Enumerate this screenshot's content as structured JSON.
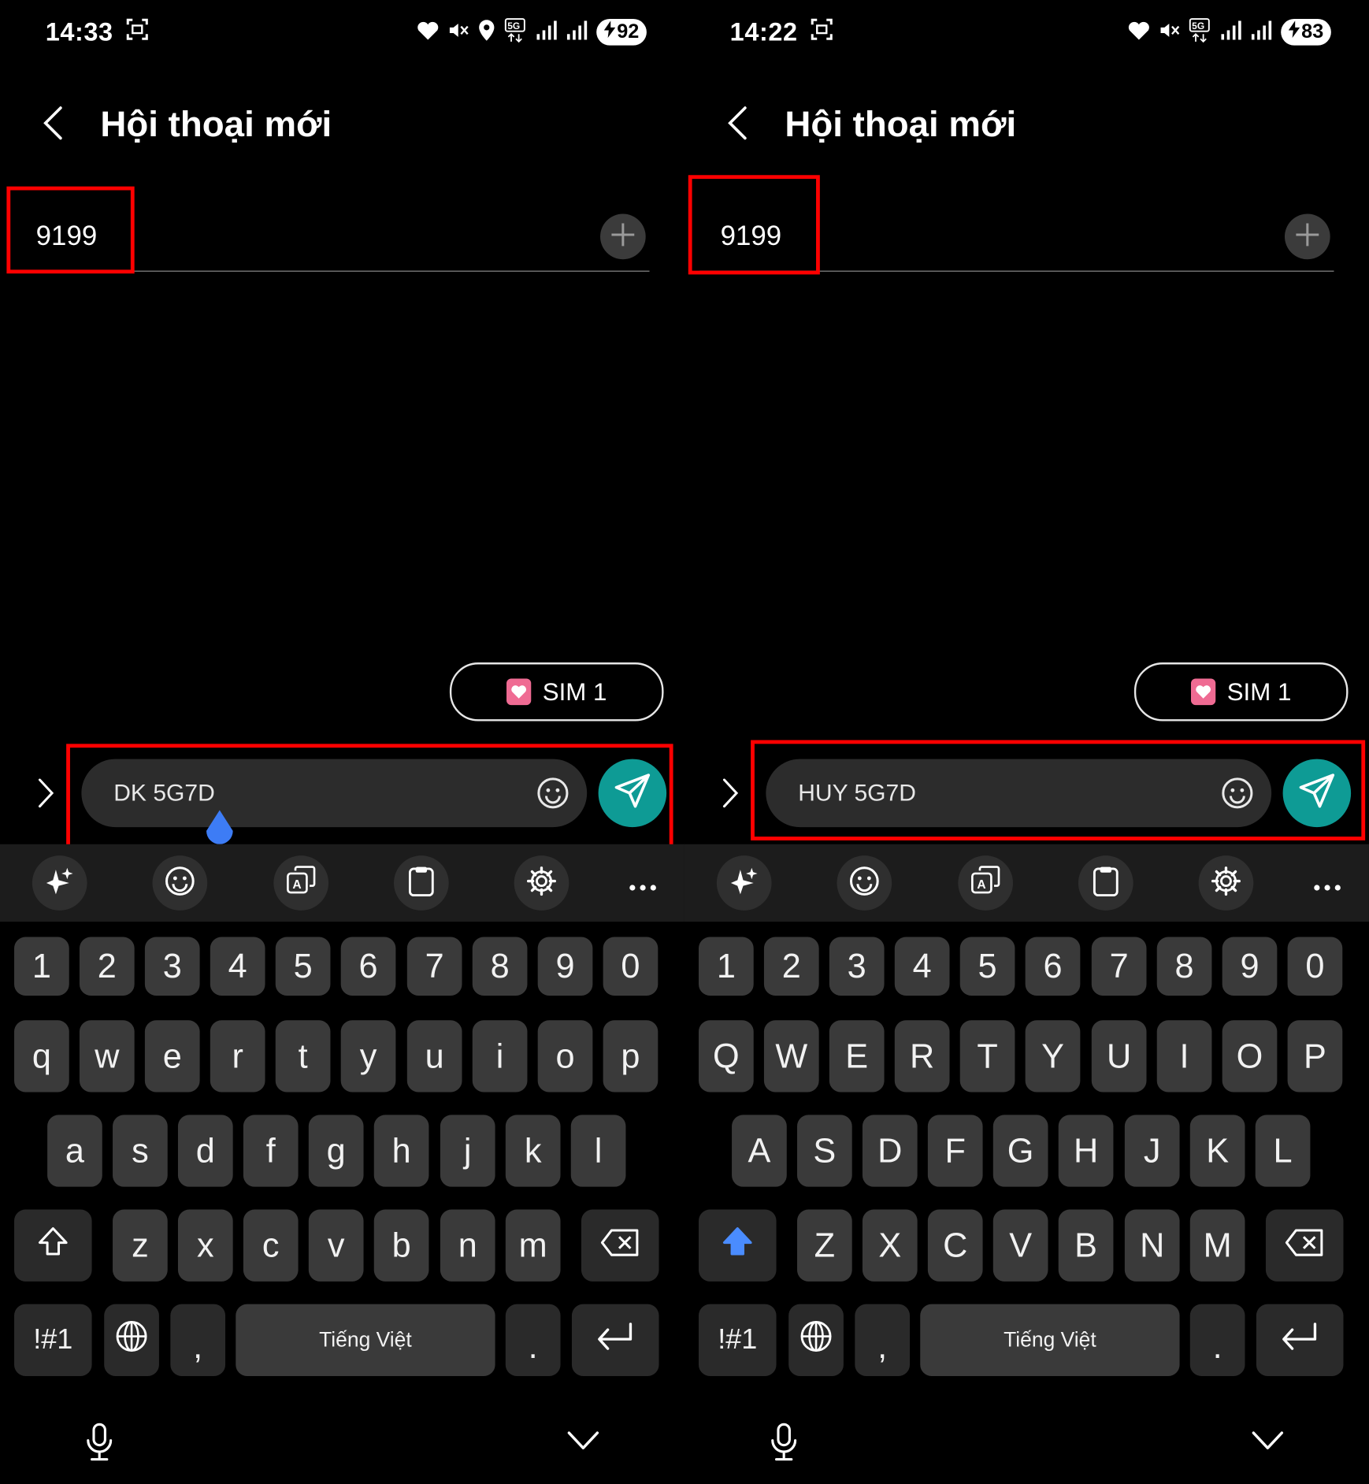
{
  "screens": [
    {
      "status": {
        "time": "14:33",
        "battery": "92"
      },
      "header": {
        "title": "Hội thoại mới"
      },
      "recipient": {
        "number": "9199"
      },
      "sim_label": "SIM 1",
      "compose": {
        "text": "DK 5G7D"
      },
      "keyboard": {
        "numbers": [
          "1",
          "2",
          "3",
          "4",
          "5",
          "6",
          "7",
          "8",
          "9",
          "0"
        ],
        "row1": [
          "q",
          "w",
          "e",
          "r",
          "t",
          "y",
          "u",
          "i",
          "o",
          "p"
        ],
        "row2": [
          "a",
          "s",
          "d",
          "f",
          "g",
          "h",
          "j",
          "k",
          "l"
        ],
        "row3": [
          "z",
          "x",
          "c",
          "v",
          "b",
          "n",
          "m"
        ],
        "symbols_label": "!#1",
        "comma": ",",
        "space_label": "Tiếng Việt",
        "period": ".",
        "shift_active": false
      }
    },
    {
      "status": {
        "time": "14:22",
        "battery": "83"
      },
      "header": {
        "title": "Hội thoại mới"
      },
      "recipient": {
        "number": "9199"
      },
      "sim_label": "SIM 1",
      "compose": {
        "text": "HUY 5G7D"
      },
      "keyboard": {
        "numbers": [
          "1",
          "2",
          "3",
          "4",
          "5",
          "6",
          "7",
          "8",
          "9",
          "0"
        ],
        "row1": [
          "Q",
          "W",
          "E",
          "R",
          "T",
          "Y",
          "U",
          "I",
          "O",
          "P"
        ],
        "row2": [
          "A",
          "S",
          "D",
          "F",
          "G",
          "H",
          "J",
          "K",
          "L"
        ],
        "row3": [
          "Z",
          "X",
          "C",
          "V",
          "B",
          "N",
          "M"
        ],
        "symbols_label": "!#1",
        "comma": ",",
        "space_label": "Tiếng Việt",
        "period": ".",
        "shift_active": true
      }
    }
  ],
  "colors": {
    "send_button": "#0e9b95",
    "highlight": "#ff0000",
    "sim_icon": "#ef6b93",
    "shift_active": "#4a8cff"
  },
  "icons": [
    "screenshot-icon",
    "heart-icon",
    "mute-icon",
    "location-icon",
    "5g-icon",
    "signal-icon",
    "charging-icon",
    "back-icon",
    "add-icon",
    "sim-icon",
    "expand-icon",
    "emoji-icon",
    "send-icon",
    "ai-sparkle-icon",
    "emoji-toolbar-icon",
    "translate-icon",
    "clipboard-icon",
    "settings-icon",
    "more-icon",
    "shift-icon",
    "backspace-icon",
    "globe-icon",
    "enter-icon",
    "mic-icon",
    "hide-keyboard-icon"
  ]
}
